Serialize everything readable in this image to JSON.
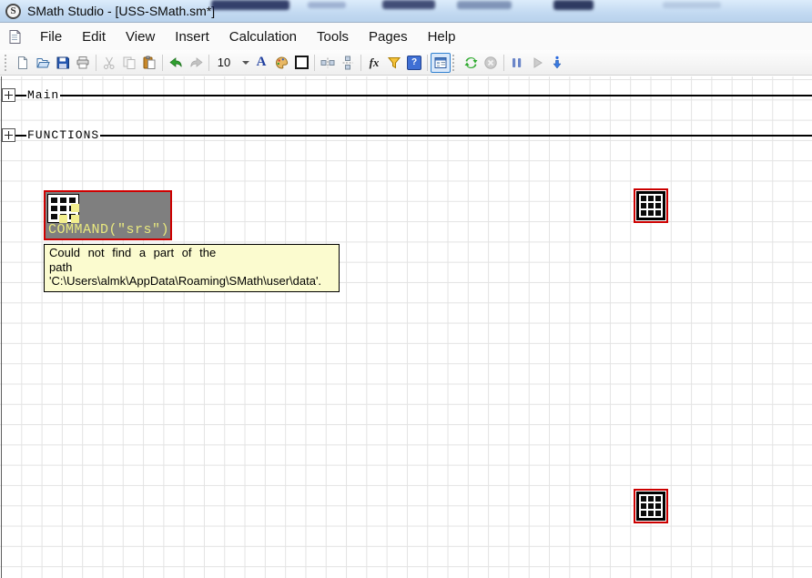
{
  "window": {
    "title": "SMath Studio - [USS-SMath.sm*]",
    "logo": "S"
  },
  "menu": {
    "items": [
      "File",
      "Edit",
      "View",
      "Insert",
      "Calculation",
      "Tools",
      "Pages",
      "Help"
    ]
  },
  "toolbar": {
    "font_size_value": "10",
    "font_color_label": "A",
    "fx_label": "fx",
    "help_label": "?"
  },
  "canvas": {
    "sections": [
      {
        "label": "Main"
      },
      {
        "label": "FUNCTIONS"
      }
    ],
    "command_expr": "COMMAND(\"srs\")",
    "tooltip": {
      "lines": [
        "Could not find a part of the",
        "path",
        "'C:\\Users\\almk\\AppData\\Roaming\\SMath\\user\\data'."
      ]
    }
  },
  "colors": {
    "selection_border": "#ce0000",
    "element_background": "#7f7f7f",
    "command_text": "#e9e97f",
    "tooltip_background": "#fbfbcf"
  }
}
